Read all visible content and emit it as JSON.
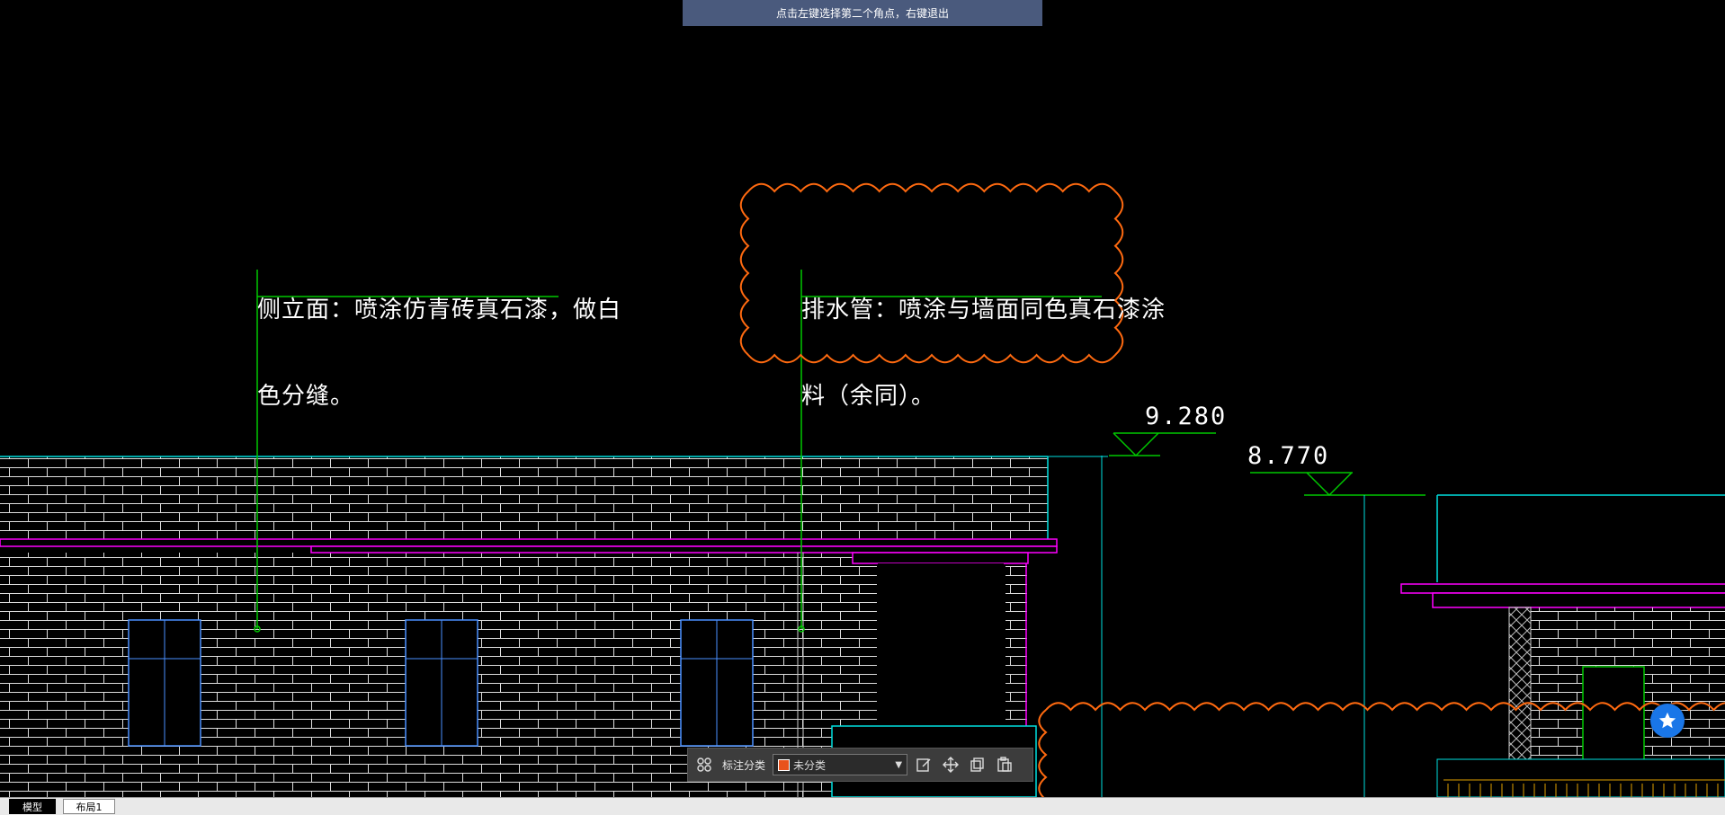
{
  "prompt": {
    "text": "点击左键选择第二个角点，右键退出"
  },
  "annotations": {
    "side_elevation_line1": "侧立面：喷涂仿青砖真石漆，做白",
    "side_elevation_line2": "色分缝。",
    "drain_pipe_line1": "排水管：喷涂与墙面同色真石漆涂",
    "drain_pipe_line2": "料（余同）。"
  },
  "elevations": {
    "upper": "9.280",
    "lower": "8.770"
  },
  "toolbar": {
    "icons": [
      "grid-icon",
      "edit-icon",
      "move-icon",
      "copy-icon",
      "paste-icon"
    ],
    "category_label": "标注分类",
    "category_value": "未分类",
    "category_color": "#e8521c"
  },
  "tabs": {
    "model": "模型",
    "layout1": "布局1"
  },
  "colors": {
    "background": "#000000",
    "brick": "#ffffff",
    "cyan": "#00e0e0",
    "magenta": "#ff00ff",
    "green": "#00c800",
    "cloud": "#ff6a10",
    "window": "#4a90ff",
    "prompt_bar": "#4a5a7d"
  }
}
